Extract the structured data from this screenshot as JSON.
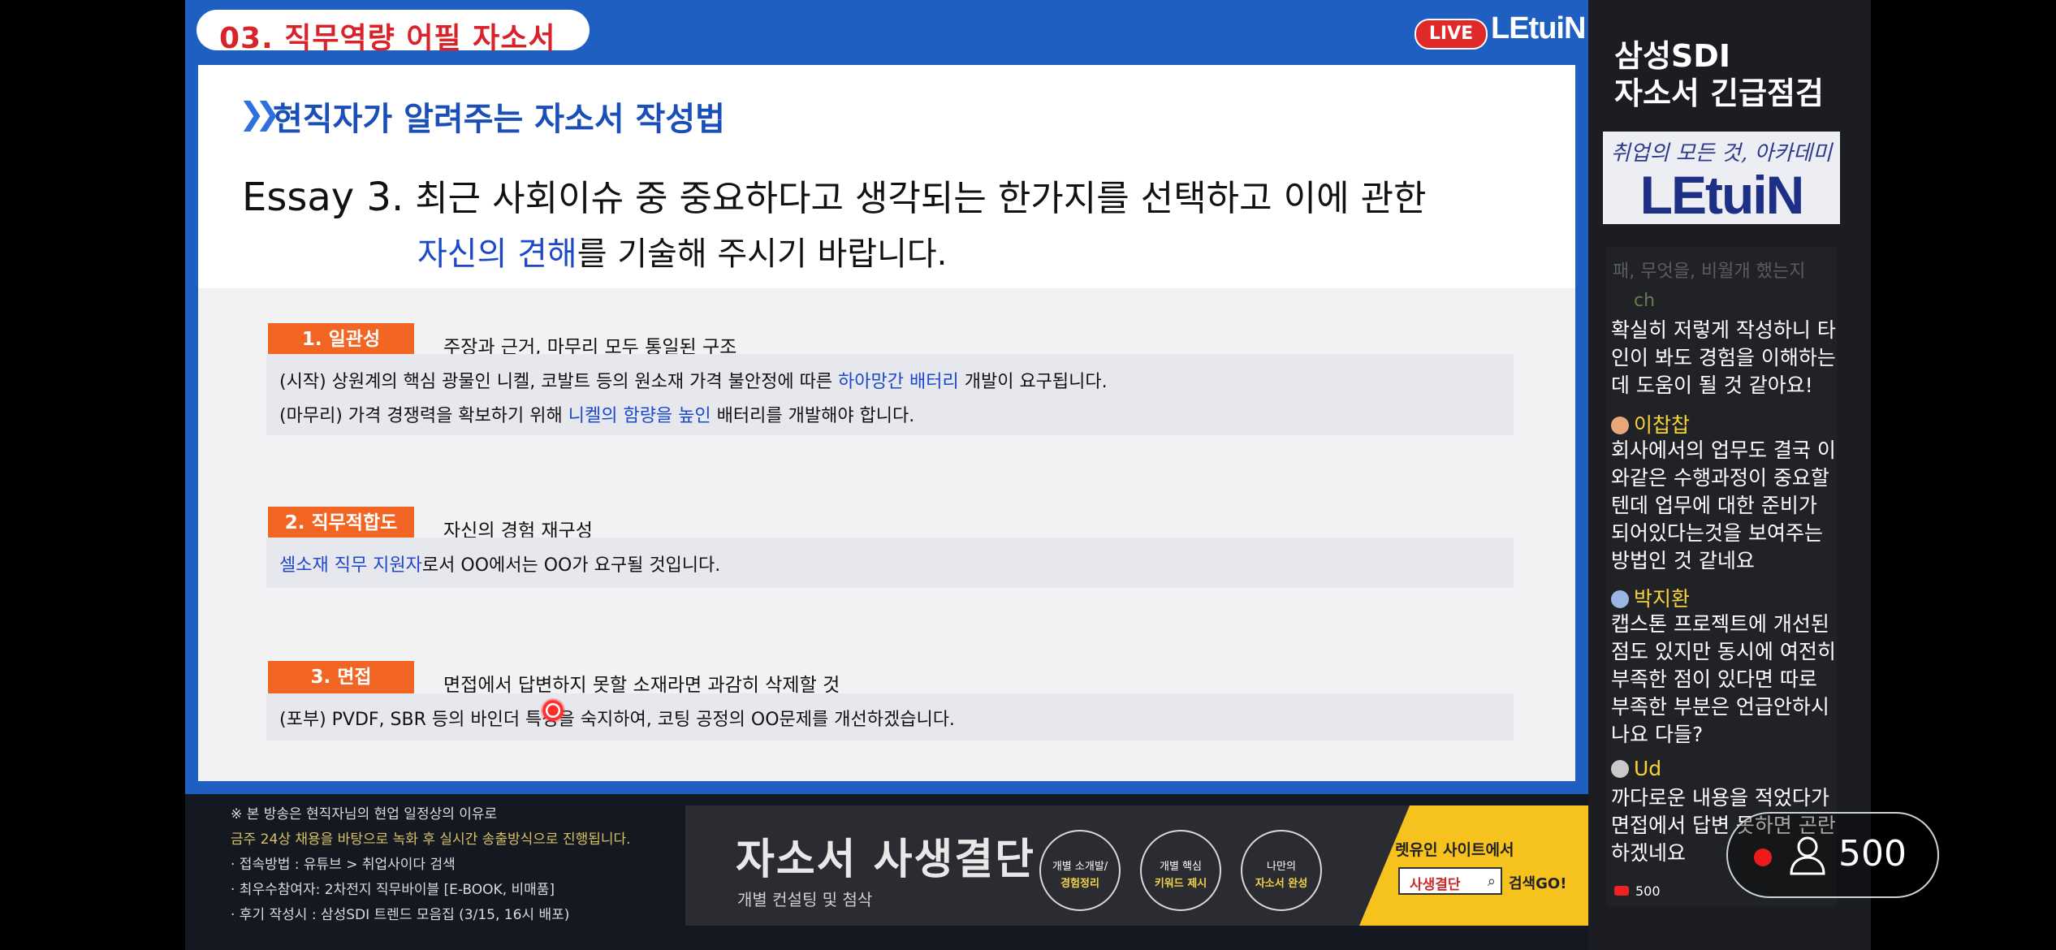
{
  "slide": {
    "section_title": "03. 직무역량 어필 자소서",
    "live_label": "LIVE",
    "brand": "LEtuiN",
    "subheading": "현직자가 알려주는 자소서 작성법",
    "essay": {
      "prefix": "Essay 3.",
      "line1": " 최근 사회이슈 중 중요하다고 생각되는 한가지를 선택하고 이에 관한",
      "line2_highlight": "자신의 견해",
      "line2_rest": "를 기술해 주시기 바랍니다."
    },
    "sections": [
      {
        "tag": "1. 일관성",
        "desc": "주장과 근거, 마무리 모두 통일된 구조",
        "lines": [
          {
            "pre": "(시작) 상원계의 핵심 광물인 니켈, 코발트 등의 원소재 가격 불안정에 따른 ",
            "hl": "하아망간 배터리",
            "post": " 개발이 요구됩니다."
          },
          {
            "pre": "(마무리) 가격 경쟁력을 확보하기 위해 ",
            "hl": "니켈의 함량을 높인",
            "post": " 배터리를 개발해야 합니다."
          }
        ]
      },
      {
        "tag": "2. 직무적합도",
        "desc": "자신의 경험 재구성",
        "lines": [
          {
            "pre": "",
            "hl": "셀소재 직무 지원자",
            "post": "로서 OO에서는 OO가 요구될 것입니다."
          }
        ]
      },
      {
        "tag": "3. 면접",
        "desc": "면접에서 답변하지 못할 소재라면 과감히 삭제할 것",
        "lines": [
          {
            "pre": "(포부) PVDF, SBR 등의 바인더 특성을 숙지하여, 코팅 공정의 OO문제를 개선하겠습니다.",
            "hl": "",
            "post": ""
          }
        ]
      }
    ]
  },
  "info_lines": [
    "※ 본 방송은 현직자님의 현업 일정상의 이유로",
    "금주 24상 채용을 바탕으로 녹화 후 실시간 송출방식으로 진행됩니다.",
    "· 접속방법 : 유튜브 > 취업사이다 검색",
    "· 최우수참여자: 2차전지 직무바이블 [E-BOOK, 비매품]",
    "· 후기 작성시 : 삼성SDI 트렌드 모음집 (3/15, 16시 배포)"
  ],
  "promo": {
    "headline": "자소서 사생결단",
    "sub": "개별 컨설팅 및 첨삭",
    "circles": [
      {
        "l1": "개별 소개발/",
        "l2": "경험정리"
      },
      {
        "l1": "개별 핵심",
        "l2": "키워드 제시"
      },
      {
        "l1": "나만의",
        "l2": "자소서 완성"
      }
    ],
    "site_text": "렛유인 사이트에서",
    "search_value": "사생결단",
    "search_go": "검색GO!"
  },
  "sidebar": {
    "title_line1": "삼성SDI",
    "title_line2": "자소서 긴급점검",
    "logo_top": "취업의 모든 것, 아카데미",
    "logo_big": "LEtuiN"
  },
  "chat": {
    "faded": "패, 무엇을, 비월개 했는지",
    "ch": "ch",
    "messages": [
      {
        "user": "",
        "text": "확실히 저렇게 작성하니 타인이 봐도 경험을 이해하는데 도움이 될 것 같아요!"
      },
      {
        "user": "이찹찹",
        "text": "회사에서의 업무도 결국 이와같은 수행과정이 중요할텐데 업무에 대한 준비가 되어있다는것을 보여주는 방법인 것 같네요"
      },
      {
        "user": "박지환",
        "text": "캡스톤 프로젝트에 개선된 점도 있지만 동시에 여전히 부족한 점이 있다면 따로 부족한 부분은 언급안하시나요 다들?"
      },
      {
        "user": "Ud",
        "text": "까다로운 내용을 적었다가 면접에서 답변 못하면 곤란하겠네요"
      }
    ],
    "viewer_count_small": "500"
  },
  "overlay": {
    "viewer_count": "500"
  },
  "colors": {
    "accent_blue": "#1f5fc2",
    "tag_orange": "#f26522",
    "live_red": "#e02a2a",
    "highlight_blue": "#1d49c9"
  }
}
